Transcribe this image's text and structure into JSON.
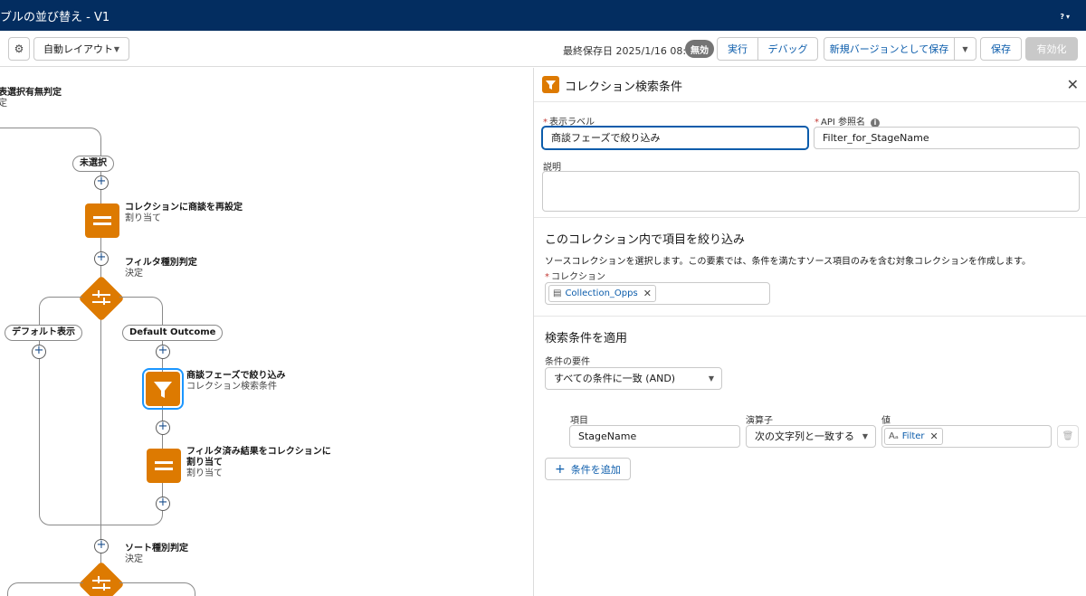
{
  "header": {
    "title": "ブルの並び替え - V1",
    "help_label": "?",
    "help_caret": "▾"
  },
  "toolbar": {
    "gear_icon": "gear-icon",
    "layout_label": "自動レイアウト",
    "last_saved": "最終保存日 2025/1/16 08:55",
    "status_badge": "無効",
    "run_label": "実行",
    "debug_label": "デバッグ",
    "save_as_label": "新規バージョンとして保存",
    "save_label": "保存",
    "activate_label": "有効化"
  },
  "canvas": {
    "top_node": {
      "name": "表選択有無判定",
      "type": "定"
    },
    "unselected_pill": "未選択",
    "reset_node": {
      "name": "コレクションに商談を再設定",
      "type": "割り当て"
    },
    "filter_decision": {
      "name": "フィルタ種別判定",
      "type": "決定"
    },
    "default_display_pill": "デフォルト表示",
    "default_outcome_pill": "Default Outcome",
    "filter_node": {
      "name": "商談フェーズで絞り込み",
      "type": "コレクション検索条件"
    },
    "assign_node": {
      "name_line1": "フィルタ済み結果をコレクションに",
      "name_line2": "割り当て",
      "type": "割り当て"
    },
    "sort_decision": {
      "name": "ソート種別判定",
      "type": "決定"
    }
  },
  "panel": {
    "title": "コレクション検索条件",
    "label_field_label": "表示ラベル",
    "label_field_value": "商談フェーズで絞り込み",
    "api_name_label": "API 参照名",
    "api_name_value": "Filter_for_StageName",
    "description_label": "説明",
    "description_value": "",
    "section1_title": "このコレクション内で項目を絞り込み",
    "section1_desc": "ソースコレクションを選択します。この要素では、条件を満たすソース項目のみを含む対象コレクションを作成します。",
    "collection_label": "コレクション",
    "collection_value": "Collection_Opps",
    "section2_title": "検索条件を適用",
    "condition_req_label": "条件の要件",
    "condition_req_value": "すべての条件に一致 (AND)",
    "col_field": "項目",
    "col_operator": "演算子",
    "col_value": "値",
    "field_value": "StageName",
    "operator_value": "次の文字列と一致する",
    "value_value": "Filter",
    "add_condition_label": "条件を追加"
  }
}
